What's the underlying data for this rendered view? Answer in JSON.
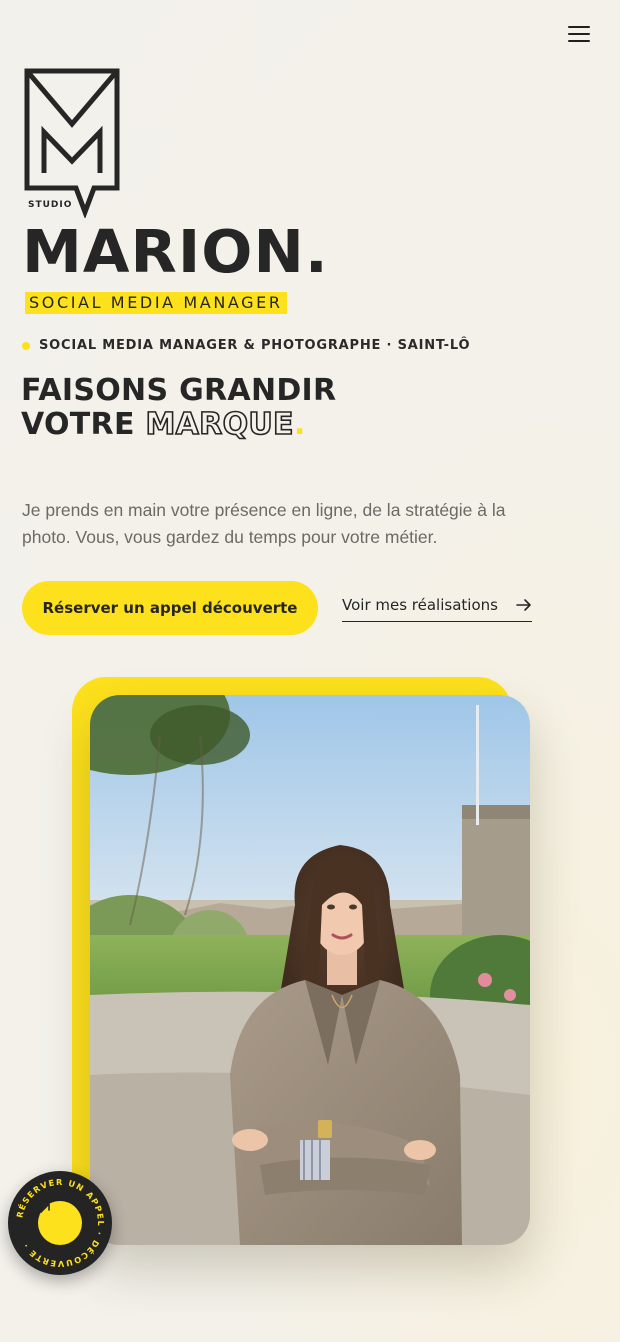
{
  "brand": {
    "logo_text": "STUDIO",
    "name": "MARION.",
    "subtitle": "SOCIAL MEDIA MANAGER"
  },
  "tagline": "SOCIAL MEDIA MANAGER & PHOTOGRAPHE · SAINT-LÔ",
  "headline": {
    "line1": "FAISONS GRANDIR",
    "line2_start": "VOTRE ",
    "line2_outline": "MARQUE",
    "line2_dot": "."
  },
  "intro": "Je prends en main votre présence en ligne, de la stratégie à la photo. Vous, vous gardez du temps pour votre métier.",
  "cta": {
    "primary": "Réserver un appel découverte",
    "secondary": "Voir mes réalisations"
  },
  "float_badge": {
    "ring_text": "RÉSERVER UN APPEL · DÉCOUVERTE ·"
  },
  "colors": {
    "accent": "#fde11c",
    "text": "#262626",
    "muted": "#6d6a65",
    "background": "#f4f1ea"
  },
  "icons": {
    "menu": "hamburger-icon",
    "arrow": "arrow-right-icon",
    "badge": "arrow-up-right-icon"
  }
}
